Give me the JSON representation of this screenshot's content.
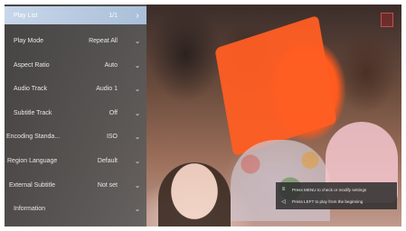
{
  "menu": {
    "items": [
      {
        "label": "Play List",
        "value": "1/1"
      },
      {
        "label": "Play Mode",
        "value": "Repeat All"
      },
      {
        "label": "Aspect Ratio",
        "value": "Auto"
      },
      {
        "label": "Audio Track",
        "value": "Audio 1"
      },
      {
        "label": "Subtitle Track",
        "value": "Off"
      },
      {
        "label": "Encoding Standa...",
        "value": "ISO"
      },
      {
        "label": "Region Language",
        "value": "Default"
      },
      {
        "label": "External Subtitle",
        "value": "Not set"
      },
      {
        "label": "Information",
        "value": ""
      }
    ],
    "selected_index": 0
  },
  "hint": {
    "menu_text": "Press MENU to check or modify settings",
    "left_text": "Press LEFT to play from the beginning",
    "menu_icon": "menu-lines-icon",
    "left_icon": "left-triangle-icon"
  }
}
